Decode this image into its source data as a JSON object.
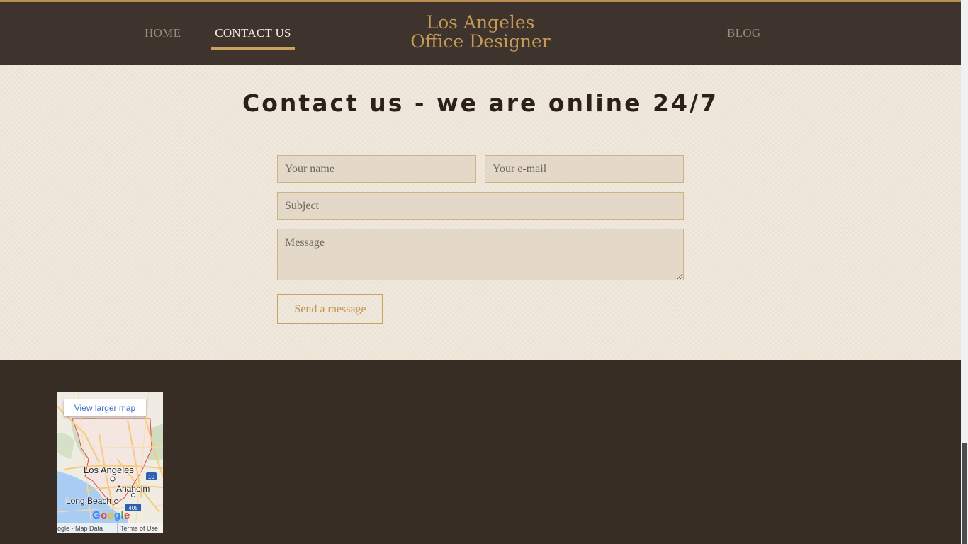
{
  "nav": {
    "home": "HOME",
    "contact": "CONTACT US",
    "blog": "BLOG"
  },
  "logo": {
    "line1": "Los Angeles",
    "line2": "Office Designer"
  },
  "main": {
    "title": "Contact us - we are online 24/7"
  },
  "form": {
    "name_placeholder": "Your name",
    "email_placeholder": "Your e-mail",
    "subject_placeholder": "Subject",
    "message_placeholder": "Message",
    "send_label": "Send a message"
  },
  "map": {
    "view_larger": "View larger map",
    "labels": {
      "los_angeles": "Los Angeles",
      "anaheim": "Anaheim",
      "long_beach": "Long Beach"
    },
    "highway_labels": [
      "10",
      "405"
    ],
    "google": "Google",
    "attribution": "oogle - Map Data",
    "terms": "Terms of Use"
  },
  "colors": {
    "header_bg": "#3e342d",
    "accent": "#c9a25f",
    "content_bg": "#f0e9dd",
    "footer_bg": "#382d24"
  }
}
